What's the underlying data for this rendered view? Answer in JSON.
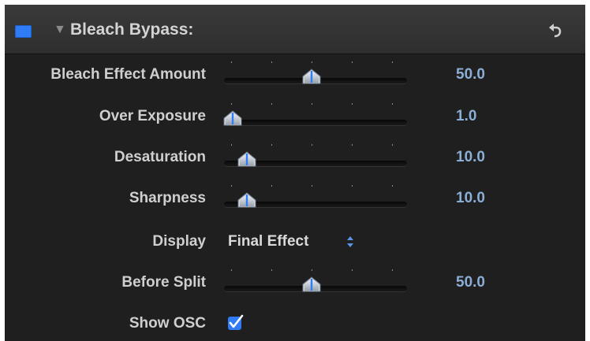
{
  "header": {
    "enable_icon": "blue-enable-checkbox",
    "disclosure_icon": "triangle-down-icon",
    "title": "Bleach Bypass:",
    "reset_icon": "reset-arrow-icon"
  },
  "params": [
    {
      "label": "Bleach Effect Amount",
      "value": "50.0",
      "level": 0.5
    },
    {
      "label": "Over Exposure",
      "value": "1.0",
      "level": 0.01
    },
    {
      "label": "Desaturation",
      "value": "10.0",
      "level": 0.1
    },
    {
      "label": "Sharpness",
      "value": "10.0",
      "level": 0.1
    }
  ],
  "display": {
    "label": "Display",
    "value": "Final Effect",
    "icon": "popup-arrows-icon"
  },
  "before_split": {
    "label": "Before Split",
    "value": "50.0",
    "level": 0.5
  },
  "show_osc": {
    "label": "Show OSC",
    "checked": true,
    "icon": "checkmark-icon"
  },
  "colors": {
    "accent": "#2f7cf6",
    "value_text": "#8aaed6",
    "panel_bg": "#1f1f1f"
  }
}
